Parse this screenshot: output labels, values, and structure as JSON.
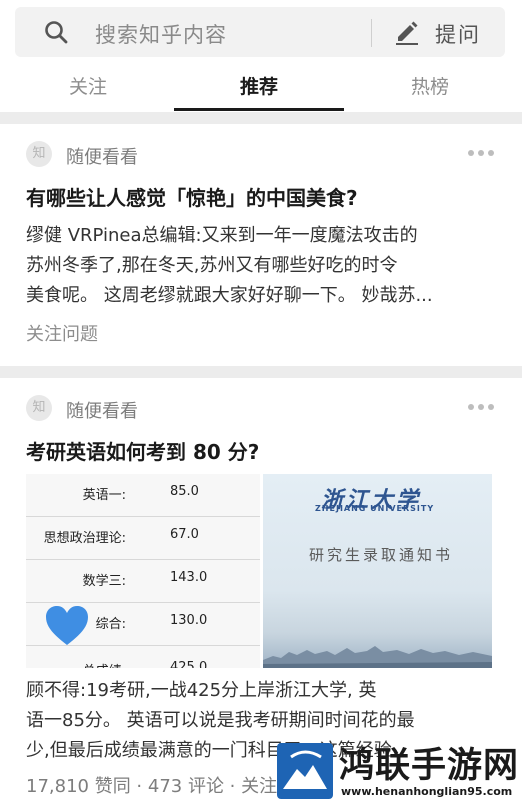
{
  "search": {
    "placeholder": "搜索知乎内容",
    "ask_label": "提问"
  },
  "tabs": [
    {
      "label": "关注",
      "active": false
    },
    {
      "label": "推荐",
      "active": true
    },
    {
      "label": "热榜",
      "active": false
    }
  ],
  "feed": [
    {
      "source_badge": "知",
      "source_label": "随便看看",
      "question": "有哪些让人感觉「惊艳」的中国美食?",
      "excerpt_lines": [
        "缪健 VRPinea总编辑:又来到一年一度魔法攻击的",
        "苏州冬季了,那在冬天,苏州又有哪些好吃的时令",
        "美食呢。 这周老缪就跟大家好好聊一下。 妙哉苏..."
      ],
      "action_label": "关注问题"
    },
    {
      "source_badge": "知",
      "source_label": "随便看看",
      "question": "考研英语如何考到 80 分?",
      "score_table": [
        {
          "label": "英语一:",
          "value": "85.0"
        },
        {
          "label": "思想政治理论:",
          "value": "67.0"
        },
        {
          "label": "数学三:",
          "value": "143.0"
        },
        {
          "label": "综合:",
          "value": "130.0"
        },
        {
          "label": "总成绩:",
          "value": "425.0"
        }
      ],
      "image_right": {
        "school_cn": "浙江大学",
        "school_en": "ZHEJIANG UNIVERSITY",
        "notice": "研究生录取通知书"
      },
      "excerpt_lines": [
        "顾不得:19考研,一战425分上岸浙江大学, 英",
        "语一85分。 英语可以说是我考研期间时间花的最",
        "少,但最后成绩最满意的一门科目了。这篇经验"
      ],
      "stats": "17,810 赞同 · 473 评论 · 关注问题"
    }
  ],
  "watermark": {
    "text_cn": "鸿联手游网",
    "url": "www.henanhonglian95.com"
  },
  "colors": {
    "accent_heart": "#3f8ee3",
    "logo_blue": "#2e5590",
    "watermark_blue": "#1e64b4"
  }
}
